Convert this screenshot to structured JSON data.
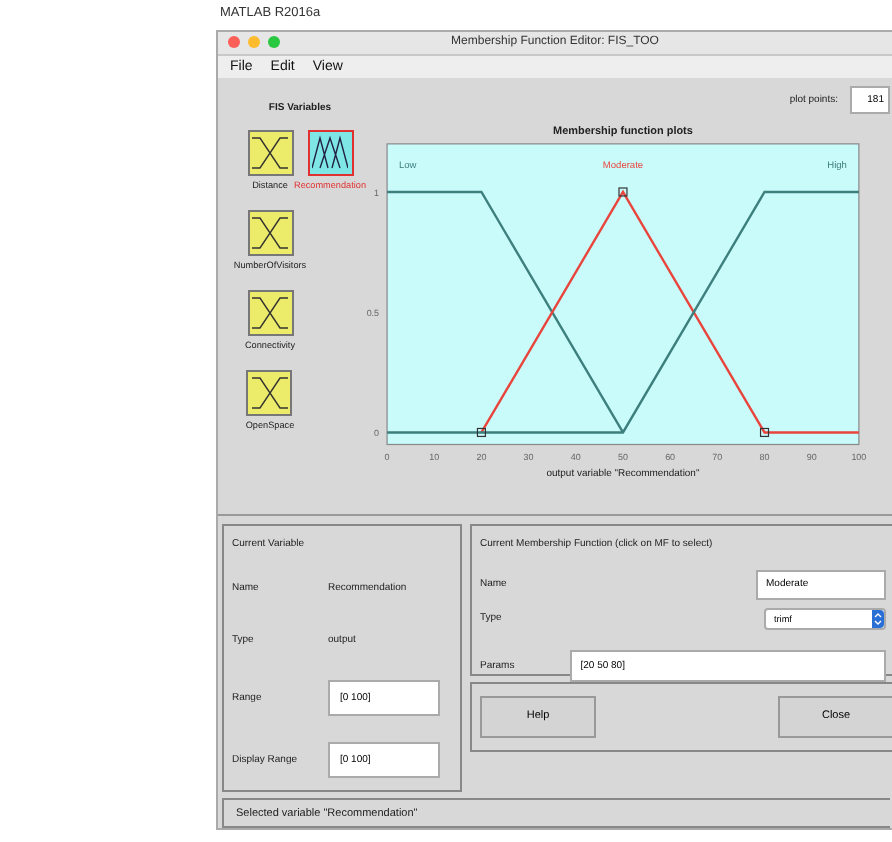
{
  "app_title": "MATLAB R2016a",
  "window": {
    "title": "Membership Function Editor: FIS_TOO"
  },
  "menu": [
    "File",
    "Edit",
    "View"
  ],
  "fis_variables": {
    "title": "FIS Variables",
    "items": [
      {
        "label": "Distance",
        "kind": "input",
        "selected": false
      },
      {
        "label": "Recommendation",
        "kind": "output",
        "selected": true
      },
      {
        "label": "NumberOfVisitors",
        "kind": "input",
        "selected": false
      },
      {
        "label": "Connectivity",
        "kind": "input",
        "selected": false
      },
      {
        "label": "OpenSpace",
        "kind": "input",
        "selected": false
      }
    ]
  },
  "plot_points": {
    "label": "plot points:",
    "value": "181"
  },
  "plot": {
    "chart_data": {
      "type": "line",
      "title": "Membership function plots",
      "xlabel": "output variable \"Recommendation\"",
      "x": [
        0,
        20,
        50,
        80,
        100
      ],
      "xlim": [
        0,
        100
      ],
      "ylim": [
        -0.05,
        1.2
      ],
      "xticks": [
        0,
        10,
        20,
        30,
        40,
        50,
        60,
        70,
        80,
        90,
        100
      ],
      "yticks": [
        0,
        0.5,
        1
      ],
      "series": [
        {
          "name": "Low",
          "color": "#3d7f7d",
          "values": [
            1,
            1,
            0,
            null,
            null
          ]
        },
        {
          "name": "Moderate",
          "color": "#e8453c",
          "values": [
            null,
            0,
            1,
            0,
            0
          ]
        },
        {
          "name": "High",
          "color": "#3d7f7d",
          "values": [
            0,
            0,
            0,
            1,
            1
          ]
        }
      ]
    }
  },
  "current_variable": {
    "title": "Current Variable",
    "rows": [
      {
        "label": "Name",
        "kind": "text",
        "value": "Recommendation"
      },
      {
        "label": "Type",
        "kind": "text",
        "value": "output"
      },
      {
        "label": "Range",
        "kind": "field",
        "value": "[0 100]"
      },
      {
        "label": "Display Range",
        "kind": "field",
        "value": "[0 100]"
      }
    ]
  },
  "current_mf": {
    "title": "Current Membership Function (click on MF to select)",
    "name_label": "Name",
    "name": "Moderate",
    "type_label": "Type",
    "type": "trimf",
    "params_label": "Params",
    "params": "[20 50 80]"
  },
  "buttons": [
    "Help",
    "Close"
  ],
  "status": "Selected variable \"Recommendation\""
}
